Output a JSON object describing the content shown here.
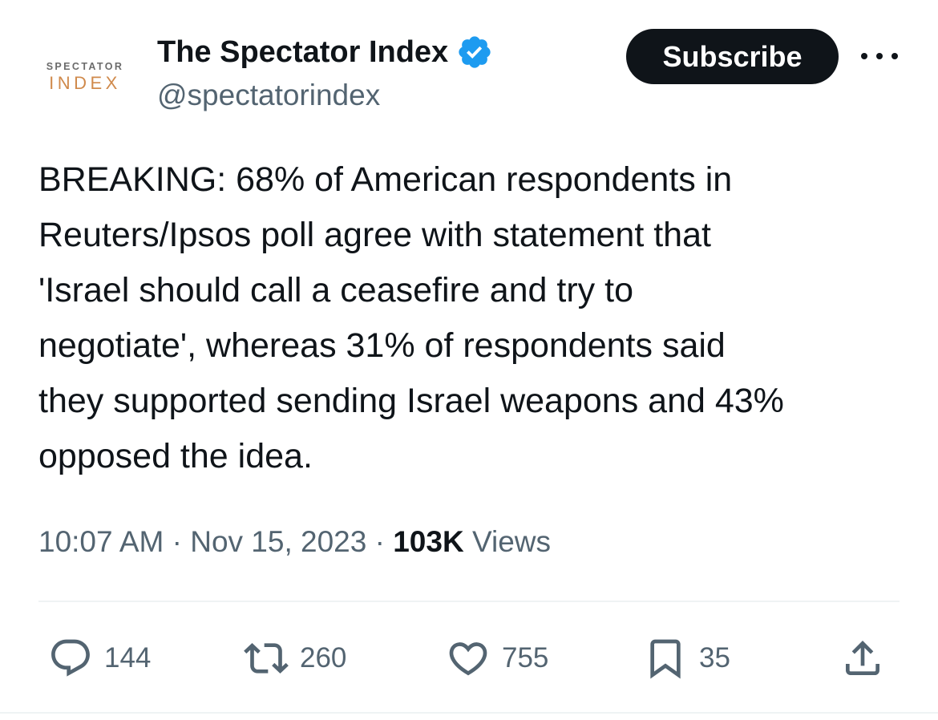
{
  "author": {
    "avatar_logo_top": "SPECTATOR",
    "avatar_logo_bottom": "INDEX",
    "name": "The Spectator Index",
    "handle": "@spectatorindex",
    "verified_icon": "verified-badge-icon"
  },
  "header": {
    "subscribe_label": "Subscribe",
    "more_icon": "more-options-icon"
  },
  "tweet": {
    "text": "BREAKING: 68% of American respondents in\nReuters/Ipsos poll agree with statement that\n'Israel should call a ceasefire and try to\nnegotiate', whereas 31% of respondents said\nthey supported sending Israel weapons and 43%\nopposed the idea."
  },
  "meta": {
    "time": "10:07 AM",
    "separator": " · ",
    "date": "Nov 15, 2023",
    "views_count": "103K",
    "views_label": " Views"
  },
  "actions": {
    "reply_count": "144",
    "retweet_count": "260",
    "like_count": "755",
    "bookmark_count": "35"
  },
  "colors": {
    "text_primary": "#0f1419",
    "text_secondary": "#536471",
    "verified_blue": "#1d9bf0",
    "logo_orange": "#d08a4c",
    "divider": "#eff3f4"
  }
}
